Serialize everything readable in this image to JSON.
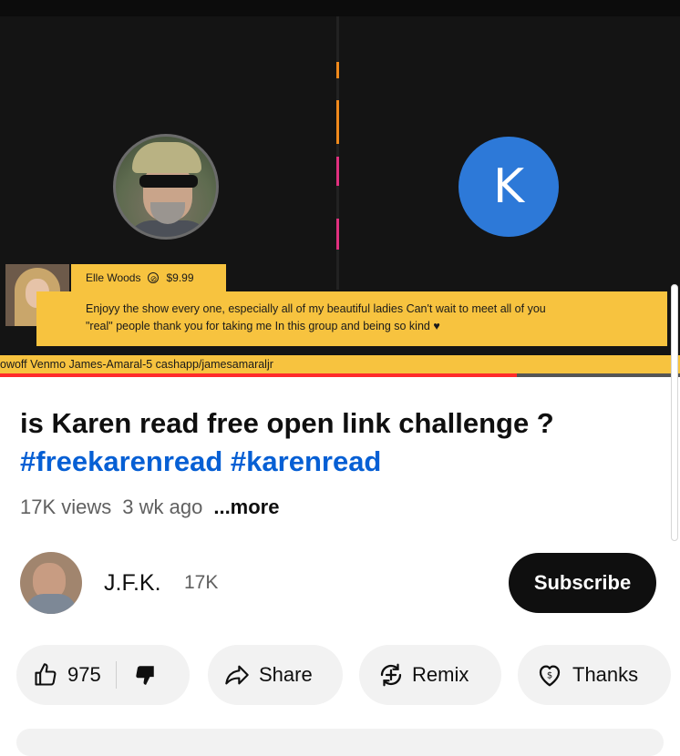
{
  "video": {
    "avatar_k_letter": "K",
    "super_chat": {
      "name": "Elle Woods",
      "amount": "$9.99",
      "message_line1": "Enjoyy the show every one, especially all of my beautiful ladies Can't wait to meet all of you",
      "message_line2": "\"real\" people thank you for taking me In this group and being so kind ♥"
    },
    "ticker_text": "owoff Venmo James-Amaral-5 cashapp/jamesamaraljr",
    "progress_fraction": 0.76
  },
  "title": {
    "text": "is Karen read free open link challenge ?",
    "hashtags": "#freekarenread #karenread"
  },
  "meta": {
    "views": "17K views",
    "age": "3 wk ago",
    "more": "...more"
  },
  "channel": {
    "name": "J.F.K.",
    "subscribers": "17K",
    "subscribe_label": "Subscribe"
  },
  "actions": {
    "like_count": "975",
    "share_label": "Share",
    "remix_label": "Remix",
    "thanks_label": "Thanks"
  },
  "colors": {
    "accent_blue": "#065fd4",
    "super_chat_yellow": "#f7c33f",
    "progress_red": "#ff2b2b",
    "avatar_k_blue": "#2d79d8"
  }
}
